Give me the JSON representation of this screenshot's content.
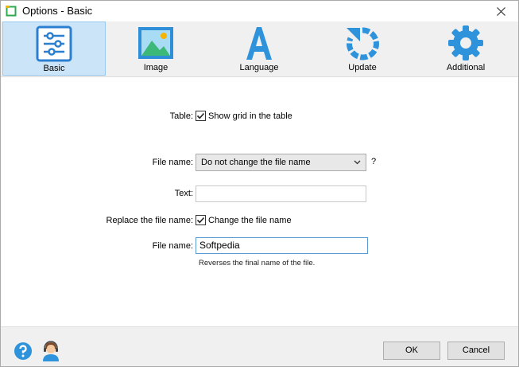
{
  "window": {
    "title": "Options - Basic"
  },
  "toolbar": {
    "items": [
      {
        "label": "Basic",
        "icon": "sliders-icon",
        "active": true
      },
      {
        "label": "Image",
        "icon": "image-icon",
        "active": false
      },
      {
        "label": "Language",
        "icon": "language-icon",
        "active": false
      },
      {
        "label": "Update",
        "icon": "update-icon",
        "active": false
      },
      {
        "label": "Additional",
        "icon": "gear-icon",
        "active": false
      }
    ]
  },
  "form": {
    "table_label": "Table:",
    "show_grid_label": "Show grid in the table",
    "show_grid_checked": true,
    "file_name_label": "File name:",
    "file_name_select_value": "Do not change the file name",
    "help_mark": "?",
    "text_label": "Text:",
    "text_value": "",
    "replace_label": "Replace the file name:",
    "change_name_label": "Change the file name",
    "change_name_checked": true,
    "file_name2_label": "File name:",
    "file_name2_value": "Softpedia",
    "hint": "Reverses the final name of the file."
  },
  "footer": {
    "ok_label": "OK",
    "cancel_label": "Cancel"
  },
  "colors": {
    "accent": "#2b8fd9",
    "active_tab_bg": "#cce4f7",
    "image_green": "#3cb878",
    "image_blue": "#2f8ed8"
  }
}
